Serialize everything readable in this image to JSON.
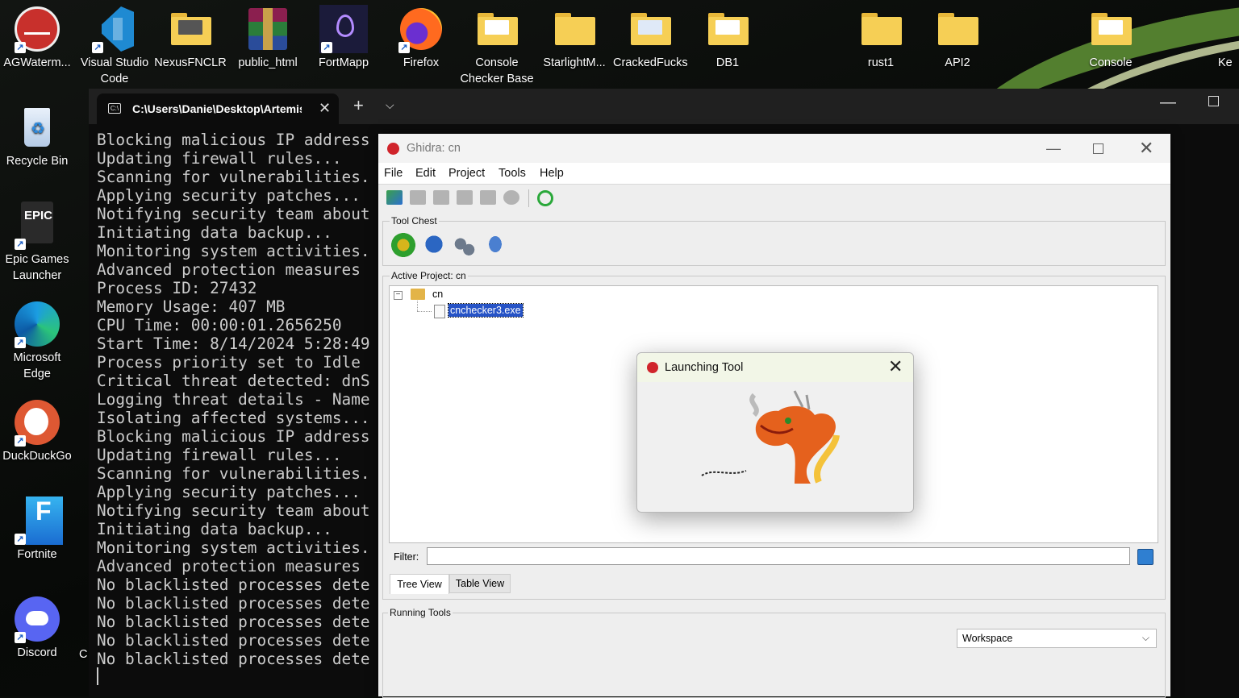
{
  "desktop": {
    "top_icons": [
      {
        "label": "AGWaterm...",
        "kind": "app"
      },
      {
        "label": "Visual Studio Code",
        "kind": "app"
      },
      {
        "label": "NexusFNCLR",
        "kind": "folder"
      },
      {
        "label": "public_html",
        "kind": "app"
      },
      {
        "label": "FortMapp",
        "kind": "app"
      },
      {
        "label": "Firefox",
        "kind": "app"
      },
      {
        "label": "Console Checker Base",
        "kind": "folder"
      },
      {
        "label": "StarlightM...",
        "kind": "folder"
      },
      {
        "label": "CrackedFucks",
        "kind": "folder"
      },
      {
        "label": "DB1",
        "kind": "folder"
      },
      {
        "label": "rust1",
        "kind": "folder"
      },
      {
        "label": "API2",
        "kind": "folder"
      },
      {
        "label": "Console",
        "kind": "folder"
      },
      {
        "label": "Ke",
        "kind": "text"
      }
    ],
    "left_icons": [
      {
        "label": "Recycle Bin"
      },
      {
        "label": "Epic Games Launcher"
      },
      {
        "label": "Microsoft Edge"
      },
      {
        "label": "DuckDuckGo"
      },
      {
        "label": "Fortnite"
      },
      {
        "label": "Discord"
      }
    ],
    "partial_label": "C"
  },
  "terminal": {
    "tab_title": "C:\\Users\\Danie\\Desktop\\Artemis",
    "lines": [
      "Blocking malicious IP address",
      "Updating firewall rules...",
      "Scanning for vulnerabilities.",
      "Applying security patches...",
      "Notifying security team about",
      "Initiating data backup...",
      "Monitoring system activities.",
      "Advanced protection measures",
      "Process ID: 27432",
      "Memory Usage: 407 MB",
      "CPU Time: 00:00:01.2656250",
      "Start Time: 8/14/2024 5:28:49",
      "Process priority set to Idle",
      "Critical threat detected: dnS",
      "Logging threat details - Name",
      "Isolating affected systems...",
      "Blocking malicious IP address",
      "Updating firewall rules...",
      "Scanning for vulnerabilities.",
      "Applying security patches...",
      "Notifying security team about",
      "Initiating data backup...",
      "Monitoring system activities.",
      "Advanced protection measures",
      "No blacklisted processes dete",
      "No blacklisted processes dete",
      "No blacklisted processes dete",
      "No blacklisted processes dete",
      "No blacklisted processes dete"
    ]
  },
  "ghidra": {
    "title": "Ghidra: cn",
    "menu": [
      "File",
      "Edit",
      "Project",
      "Tools",
      "Help"
    ],
    "tool_chest_label": "Tool Chest",
    "active_project_label": "Active Project: cn",
    "tree_root": "cn",
    "tree_file": "cnchecker3.exe",
    "filter_label": "Filter:",
    "filter_value": "",
    "tab_tree": "Tree View",
    "tab_table": "Table View",
    "running_tools_label": "Running Tools",
    "workspace_value": "Workspace"
  },
  "launch_dialog": {
    "title": "Launching Tool"
  }
}
